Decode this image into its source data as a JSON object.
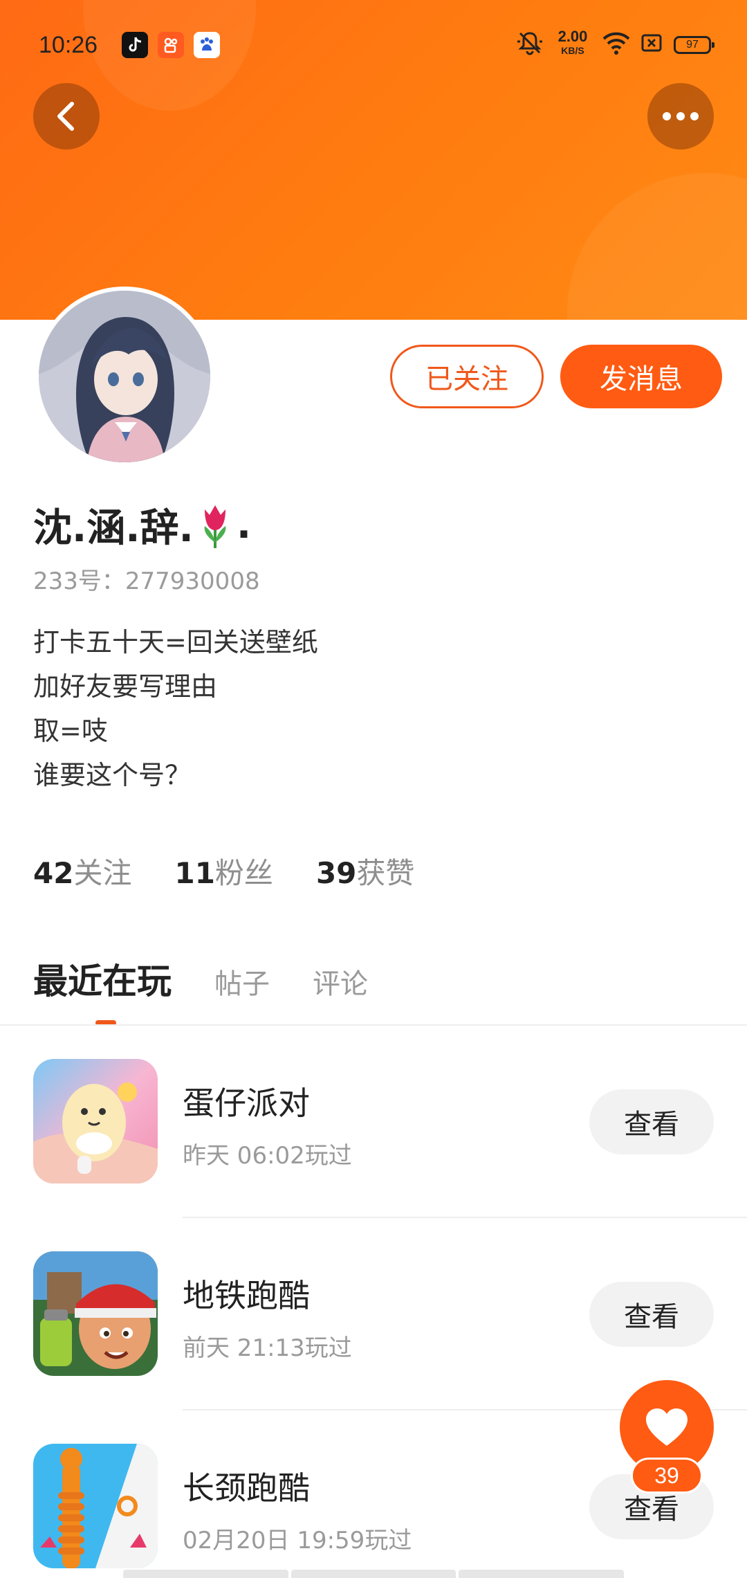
{
  "status_bar": {
    "time": "10:26",
    "net_speed_value": "2.00",
    "net_speed_unit": "KB/S",
    "battery": "97",
    "app_icons": [
      "tiktok-icon",
      "kuaishou-icon",
      "baidu-icon"
    ]
  },
  "header": {
    "gradient_colors": [
      "#ff6a14",
      "#ff8a14"
    ]
  },
  "profile": {
    "follow_label": "已关注",
    "message_label": "发消息",
    "username": "沈.涵.辞.",
    "username_suffix": ".",
    "uid": "233号：277930008",
    "bio": [
      "打卡五十天=回关送壁纸",
      "加好友要写理由",
      "取=吱",
      "谁要这个号？"
    ],
    "stats": [
      {
        "num": "42",
        "label": "关注"
      },
      {
        "num": "11",
        "label": "粉丝"
      },
      {
        "num": "39",
        "label": "获赞"
      }
    ]
  },
  "tabs": [
    {
      "label": "最近在玩",
      "active": true
    },
    {
      "label": "帖子",
      "active": false
    },
    {
      "label": "评论",
      "active": false
    }
  ],
  "games": [
    {
      "name": "蛋仔派对",
      "played": "昨天 06:02玩过",
      "button": "查看"
    },
    {
      "name": "地铁跑酷",
      "played": "前天 21:13玩过",
      "button": "查看"
    },
    {
      "name": "长颈跑酷",
      "played": "02月20日 19:59玩过",
      "button": "查看"
    }
  ],
  "like": {
    "count": "39"
  },
  "accent_color": "#ff5b12"
}
